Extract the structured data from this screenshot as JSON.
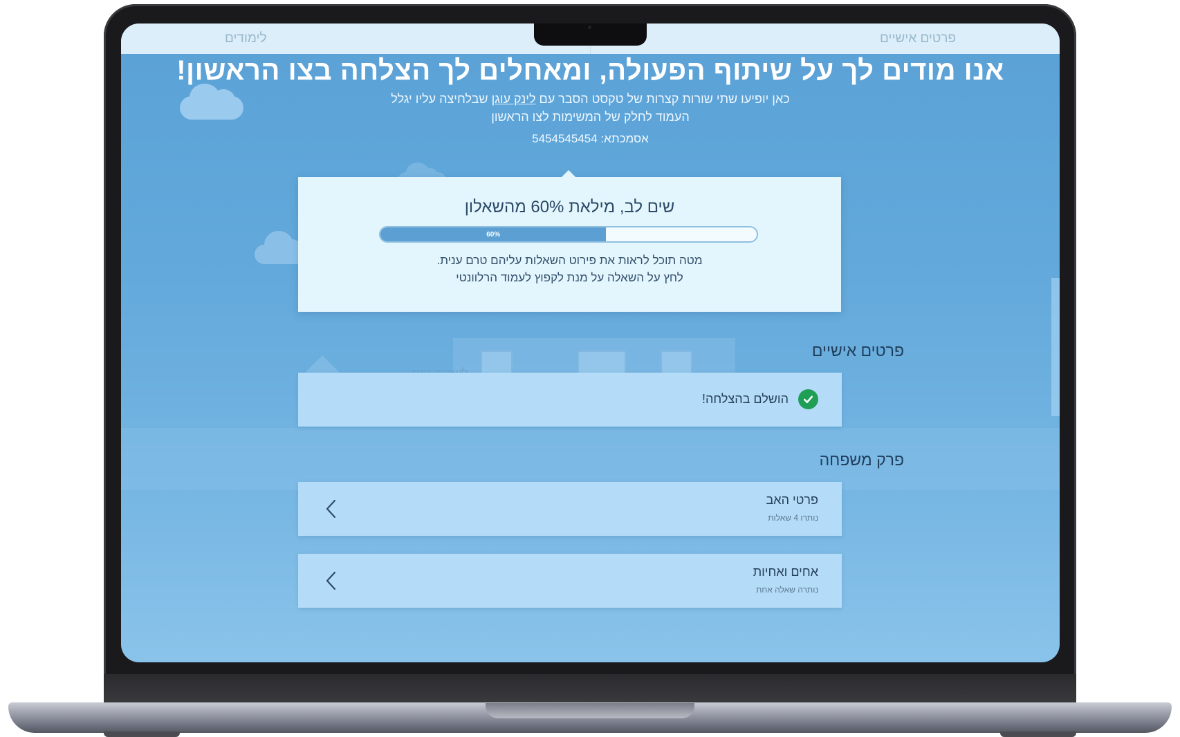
{
  "top_tabs": {
    "right": "פרטים אישיים",
    "left": "לימודים"
  },
  "header": {
    "headline": "אנו מודים לך על שיתוף הפעולה, ומאחלים לך הצלחה בצו הראשון!",
    "subtext_before_link": "כאן יופיעו שתי שורות קצרות של טקסט הסבר עם ",
    "subtext_link": "לינק עוגן",
    "subtext_after_link": " שבלחיצה עליו יגלל",
    "subtext_line2": "העמוד לחלק של המשימות לצו הראשון",
    "reference": "אסמכתא: 5454545454"
  },
  "background": {
    "sign_text": "לשכת גיוס"
  },
  "progress": {
    "title": "שים לב, מילאת 60% מהשאלון",
    "percent": 60,
    "bar_label": "60%",
    "note_line1": "מטה תוכל לראות את פירוט השאלות עליהם טרם ענית.",
    "note_line2": "לחץ על השאלה על מנת לקפוץ לעמוד הרלוונטי"
  },
  "sections": {
    "personal": {
      "title": "פרטים אישיים",
      "status": "הושלם בהצלחה!"
    },
    "family": {
      "title": "פרק משפחה",
      "items": [
        {
          "title": "פרטי האב",
          "subtitle": "נותרו 4 שאלות"
        },
        {
          "title": "אחים ואחיות",
          "subtitle": "נותרה שאלה אחת"
        }
      ]
    }
  },
  "colors": {
    "screen_bg": "#5aa1d6",
    "card_bg": "#e3f6fd",
    "row_bg": "#b4dcf8",
    "progress_fill": "#5b9fd3",
    "success": "#1f9f55",
    "text_dark": "#26405a"
  },
  "icons": {
    "success": "check-circle-icon",
    "navigate": "chevron-left-icon"
  }
}
